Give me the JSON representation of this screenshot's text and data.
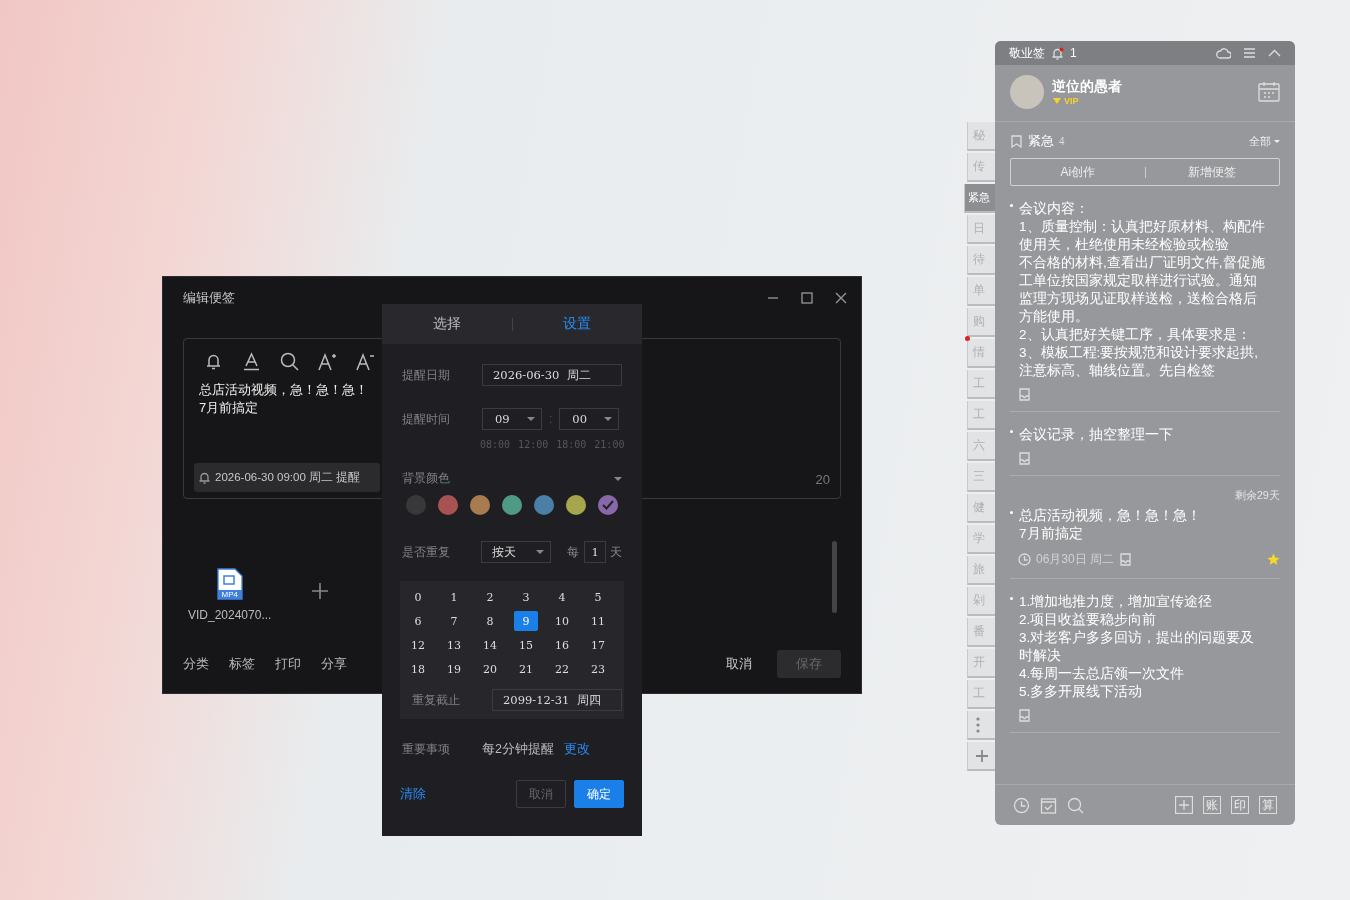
{
  "edit_window": {
    "title": "编辑便签",
    "note_lines": [
      "总店活动视频，急！急！急！",
      "7月前搞定"
    ],
    "reminder": "2026-06-30 09:00 周二 提醒",
    "char_count": "20",
    "attachment": {
      "type": "MP4",
      "name": "VID_2024070..."
    },
    "actions": [
      "分类",
      "标签",
      "打印",
      "分享"
    ],
    "cancel": "取消",
    "save": {
      "label": "保存",
      "disabled": true
    }
  },
  "reminder_popup": {
    "tabs": [
      {
        "label": "选择",
        "selected": false
      },
      {
        "label": "设置",
        "selected": true
      }
    ],
    "date": {
      "label": "提醒日期",
      "value": "2026-06-30  周二"
    },
    "time": {
      "label": "提醒时间",
      "hour": "09",
      "separator": ":",
      "minute": "00",
      "presets": [
        "08:00",
        "12:00",
        "18:00",
        "21:00"
      ]
    },
    "background": {
      "label": "背景颜色",
      "colors": [
        {
          "color": "#38383b",
          "selected": false
        },
        {
          "color": "#a85353",
          "selected": false
        },
        {
          "color": "#a87c4f",
          "selected": false
        },
        {
          "color": "#4f9a85",
          "selected": false
        },
        {
          "color": "#4a7fa8",
          "selected": false
        },
        {
          "color": "#a6a64c",
          "selected": false
        },
        {
          "color": "#8868a8",
          "selected": true
        }
      ]
    },
    "repeat": {
      "label": "是否重复",
      "mode": "按天",
      "every": "每",
      "interval": "1",
      "unit": "天",
      "hours": [
        {
          "label": "0",
          "selected": false
        },
        {
          "label": "1",
          "selected": false
        },
        {
          "label": "2",
          "selected": false
        },
        {
          "label": "3",
          "selected": false
        },
        {
          "label": "4",
          "selected": false
        },
        {
          "label": "5",
          "selected": false
        },
        {
          "label": "6",
          "selected": false
        },
        {
          "label": "7",
          "selected": false
        },
        {
          "label": "8",
          "selected": false
        },
        {
          "label": "9",
          "selected": true
        },
        {
          "label": "10",
          "selected": false
        },
        {
          "label": "11",
          "selected": false
        },
        {
          "label": "12",
          "selected": false
        },
        {
          "label": "13",
          "selected": false
        },
        {
          "label": "14",
          "selected": false
        },
        {
          "label": "15",
          "selected": false
        },
        {
          "label": "16",
          "selected": false
        },
        {
          "label": "17",
          "selected": false
        },
        {
          "label": "18",
          "selected": false
        },
        {
          "label": "19",
          "selected": false
        },
        {
          "label": "20",
          "selected": false
        },
        {
          "label": "21",
          "selected": false
        },
        {
          "label": "22",
          "selected": false
        },
        {
          "label": "23",
          "selected": false
        }
      ],
      "until_label": "重复截止",
      "until": "2099-12-31  周四"
    },
    "important": {
      "label": "重要事项",
      "value": "每2分钟提醒",
      "change": "更改"
    },
    "clear": "清除",
    "cancel": "取消",
    "confirm": "确定"
  },
  "side_tabs": [
    {
      "label": "秘",
      "selected": false,
      "dot": false
    },
    {
      "label": "传",
      "selected": false,
      "dot": false
    },
    {
      "label": "紧急",
      "selected": true,
      "dot": false
    },
    {
      "label": "日",
      "selected": false,
      "dot": false
    },
    {
      "label": "待",
      "selected": false,
      "dot": false
    },
    {
      "label": "单",
      "selected": false,
      "dot": false
    },
    {
      "label": "购",
      "selected": false,
      "dot": false
    },
    {
      "label": "情",
      "selected": false,
      "dot": true
    },
    {
      "label": "工",
      "selected": false,
      "dot": false
    },
    {
      "label": "工",
      "selected": false,
      "dot": false
    },
    {
      "label": "六",
      "selected": false,
      "dot": false
    },
    {
      "label": "三",
      "selected": false,
      "dot": false
    },
    {
      "label": "健",
      "selected": false,
      "dot": false
    },
    {
      "label": "学",
      "selected": false,
      "dot": false
    },
    {
      "label": "旅",
      "selected": false,
      "dot": false
    },
    {
      "label": "剁",
      "selected": false,
      "dot": false
    },
    {
      "label": "番",
      "selected": false,
      "dot": false
    },
    {
      "label": "开",
      "selected": false,
      "dot": false
    },
    {
      "label": "工",
      "selected": false,
      "dot": false
    }
  ],
  "note_panel": {
    "app_name": "敬业签",
    "notification_count": "1",
    "user": {
      "name": "逆位的愚者",
      "badge": "VIP"
    },
    "category": {
      "name": "紧急",
      "count": "4",
      "filter": "全部"
    },
    "buttons": [
      "Ai创作",
      "新增便签"
    ],
    "notes": [
      {
        "lines": [
          "会议内容：",
          "1、质量控制：认真把好原材料、构配件使用关，杜绝使用未经检验或检验",
          "不合格的材料,查看出厂证明文件,督促施工单位按国家规定取样进行试验。通知监理方现场见证取样送检，送检合格后方能使用。",
          "2、认真把好关键工序，具体要求是：",
          "3、模板工程:要按规范和设计要求起拱,注意标高、轴线位置。先自检签"
        ],
        "starred": false
      },
      {
        "lines": [
          "会议记录，抽空整理一下"
        ],
        "starred": false
      },
      {
        "remaining": "剩余29天",
        "lines": [
          "总店活动视频，急！急！急！",
          "7月前搞定"
        ],
        "date": "06月30日 周二",
        "starred": true
      },
      {
        "lines": [
          "1.增加地推力度，增加宣传途径",
          "2.项目收益要稳步向前",
          "3.对老客户多多回访，提出的问题要及时解决",
          "4.每周一去总店领一次文件",
          "5.多多开展线下活动"
        ],
        "starred": false
      }
    ],
    "tools": [
      "账",
      "印",
      "算"
    ]
  }
}
